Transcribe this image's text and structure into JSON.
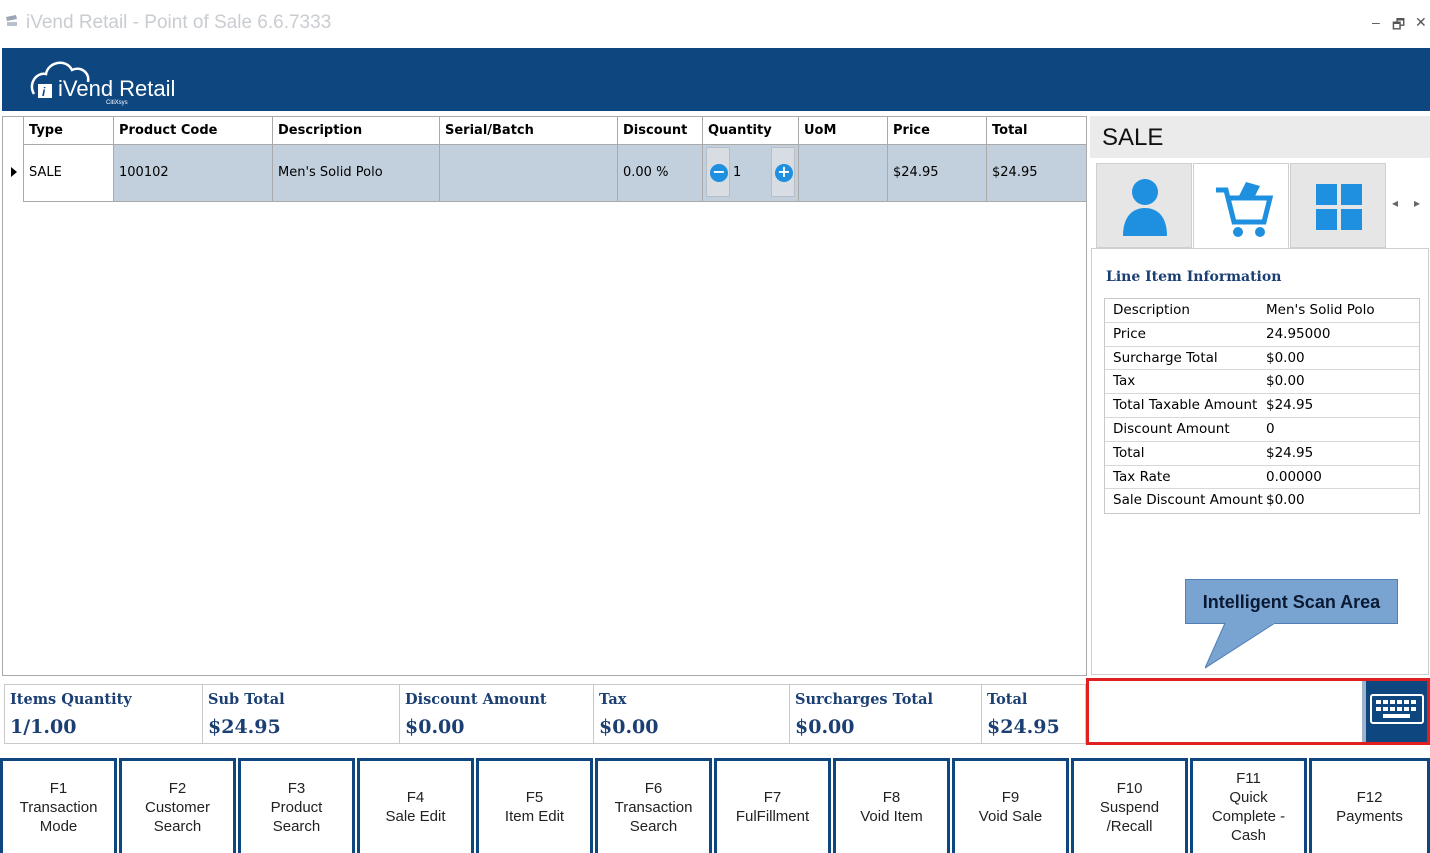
{
  "window": {
    "title": "iVend Retail - Point of Sale 6.6.7333",
    "controls": [
      "–",
      "🗗",
      "✕"
    ]
  },
  "banner": {
    "logo_text": "iVend Retail",
    "logo_sub": "CitiXsys"
  },
  "grid": {
    "columns": [
      "Type",
      "Product Code",
      "Description",
      "Serial/Batch",
      "Discount",
      "Quantity",
      "UoM",
      "Price",
      "Total"
    ],
    "rows": [
      {
        "type": "SALE",
        "product_code": "100102",
        "description": "Men's Solid Polo",
        "serial_batch": "",
        "discount": "0.00 %",
        "quantity": "1",
        "uom": "",
        "price": "$24.95",
        "total": "$24.95"
      }
    ]
  },
  "right_panel": {
    "heading": "SALE",
    "tabs": [
      {
        "icon": "customer-icon",
        "active": false
      },
      {
        "icon": "cart-icon",
        "active": true
      },
      {
        "icon": "grid-icon",
        "active": false
      }
    ],
    "info_title": "Line Item Information",
    "info": [
      {
        "key": "Description",
        "value": "Men's Solid Polo"
      },
      {
        "key": "Price",
        "value": "24.95000"
      },
      {
        "key": "Surcharge Total",
        "value": "$0.00"
      },
      {
        "key": "Tax",
        "value": "$0.00"
      },
      {
        "key": "Total Taxable Amount",
        "value": "$24.95"
      },
      {
        "key": "Discount Amount",
        "value": "0"
      },
      {
        "key": "Total",
        "value": "$24.95"
      },
      {
        "key": "Tax Rate",
        "value": "0.00000"
      },
      {
        "key": "Sale Discount Amount",
        "value": "$0.00"
      }
    ]
  },
  "callout": {
    "text": "Intelligent Scan Area"
  },
  "totals": [
    {
      "label": "Items Quantity",
      "value": "1/1.00"
    },
    {
      "label": "Sub Total",
      "value": "$24.95"
    },
    {
      "label": "Discount Amount",
      "value": "$0.00"
    },
    {
      "label": "Tax",
      "value": "$0.00"
    },
    {
      "label": "Surcharges Total",
      "value": "$0.00"
    },
    {
      "label": "Total",
      "value": "$24.95"
    }
  ],
  "scan": {
    "placeholder": ""
  },
  "function_keys": [
    {
      "key": "F1",
      "label": "Transaction\nMode"
    },
    {
      "key": "F2",
      "label": "Customer\nSearch"
    },
    {
      "key": "F3",
      "label": "Product\nSearch"
    },
    {
      "key": "F4",
      "label": "Sale Edit"
    },
    {
      "key": "F5",
      "label": "Item Edit"
    },
    {
      "key": "F6",
      "label": "Transaction\nSearch"
    },
    {
      "key": "F7",
      "label": "FulFillment"
    },
    {
      "key": "F8",
      "label": "Void Item"
    },
    {
      "key": "F9",
      "label": "Void Sale"
    },
    {
      "key": "F10",
      "label": "Suspend\n/Recall"
    },
    {
      "key": "F11",
      "label": "Quick\nComplete -\nCash"
    },
    {
      "key": "F12",
      "label": "Payments"
    }
  ],
  "colors": {
    "brand": "#0e4780",
    "row_highlight": "#c2cfdd",
    "accent_blue": "#1f90e0",
    "callout": "#79a4d2",
    "scan_border": "#e02020"
  }
}
